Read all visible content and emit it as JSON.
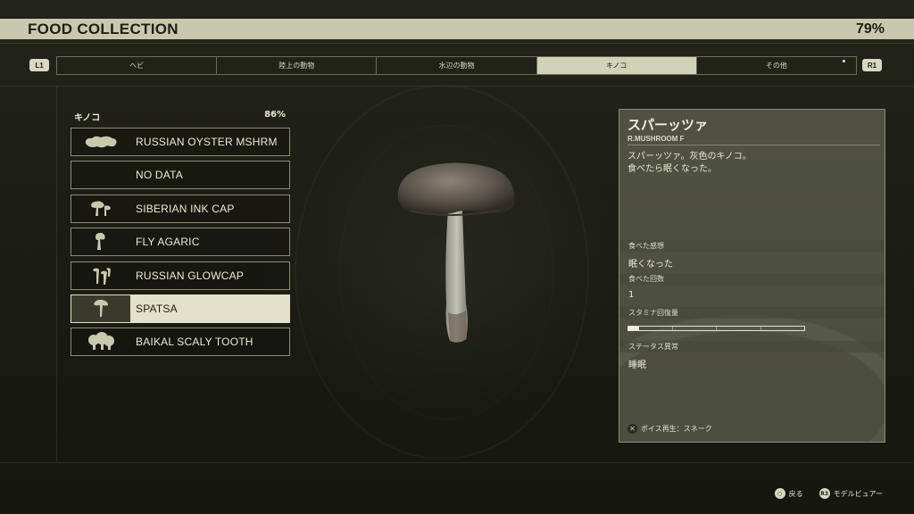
{
  "header": {
    "title": "FOOD COLLECTION",
    "completion": "79%"
  },
  "tabs": {
    "prev_button": "L1",
    "next_button": "R1",
    "items": [
      {
        "label": "ヘビ"
      },
      {
        "label": "陸上の動物"
      },
      {
        "label": "水辺の動物"
      },
      {
        "label": "キノコ",
        "active": true
      },
      {
        "label": "その他"
      }
    ]
  },
  "list": {
    "category": "キノコ",
    "percent": "86%",
    "items": [
      {
        "label": "RUSSIAN OYSTER MSHRM",
        "icon": "oyster-mushroom-icon"
      },
      {
        "label": "NO DATA",
        "icon": ""
      },
      {
        "label": "SIBERIAN INK CAP",
        "icon": "ink-cap-icon"
      },
      {
        "label": "FLY AGARIC",
        "icon": "fly-agaric-icon"
      },
      {
        "label": "RUSSIAN GLOWCAP",
        "icon": "glowcap-icon"
      },
      {
        "label": "SPATSA",
        "icon": "spatsa-icon",
        "selected": true
      },
      {
        "label": "BAIKAL SCALY TOOTH",
        "icon": "scaly-tooth-icon"
      }
    ]
  },
  "detail": {
    "name": "スパーッツァ",
    "subtitle": "R.MUSHROOM F",
    "description_line1": "スパーッツァ。灰色のキノコ。",
    "description_line2": "食べたら眠くなった。",
    "taste_label": "食べた感想",
    "taste_value": "眠くなった",
    "eaten_label": "食べた回数",
    "eaten_value": "1",
    "stamina_label": "スタミナ回復量",
    "stamina_level": 0.06,
    "status_label": "ステータス異常",
    "status_value": "睡眠",
    "voice_button": "✕",
    "voice_label": "ボイス再生：スネーク"
  },
  "footer": {
    "back_button": "○",
    "back_label": "戻る",
    "viewer_button": "R3",
    "viewer_label": "モデルビュアー"
  },
  "colors": {
    "accent": "#c9c8ae",
    "background": "#1b1c14",
    "panel": "#7a7c64"
  }
}
